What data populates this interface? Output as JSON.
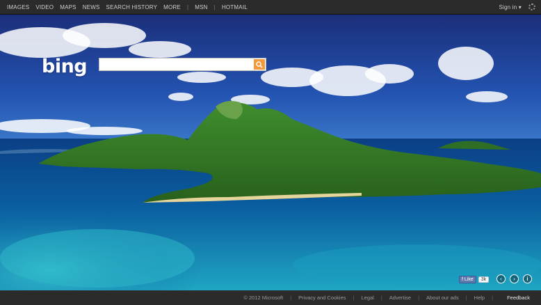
{
  "nav": {
    "items": [
      "IMAGES",
      "VIDEO",
      "MAPS",
      "NEWS",
      "SEARCH HISTORY",
      "MORE"
    ],
    "extra": [
      "MSN",
      "HOTMAIL"
    ],
    "separator": "|"
  },
  "account": {
    "signin": "Sign in"
  },
  "logo": {
    "text": "bing"
  },
  "search": {
    "value": "",
    "placeholder": ""
  },
  "social": {
    "like_label": "Like",
    "like_count": "3k"
  },
  "footer": {
    "copyright": "© 2012 Microsoft",
    "links": [
      "Privacy and Cookies",
      "Legal",
      "Advertise",
      "About our ads",
      "Help"
    ],
    "feedback": "Feedback"
  },
  "colors": {
    "search_button": "#f39a3b",
    "sky": "#1c3f92",
    "sea": "#0a7fa0",
    "island": "#3c8a2a",
    "bar": "#2b2b2b"
  }
}
